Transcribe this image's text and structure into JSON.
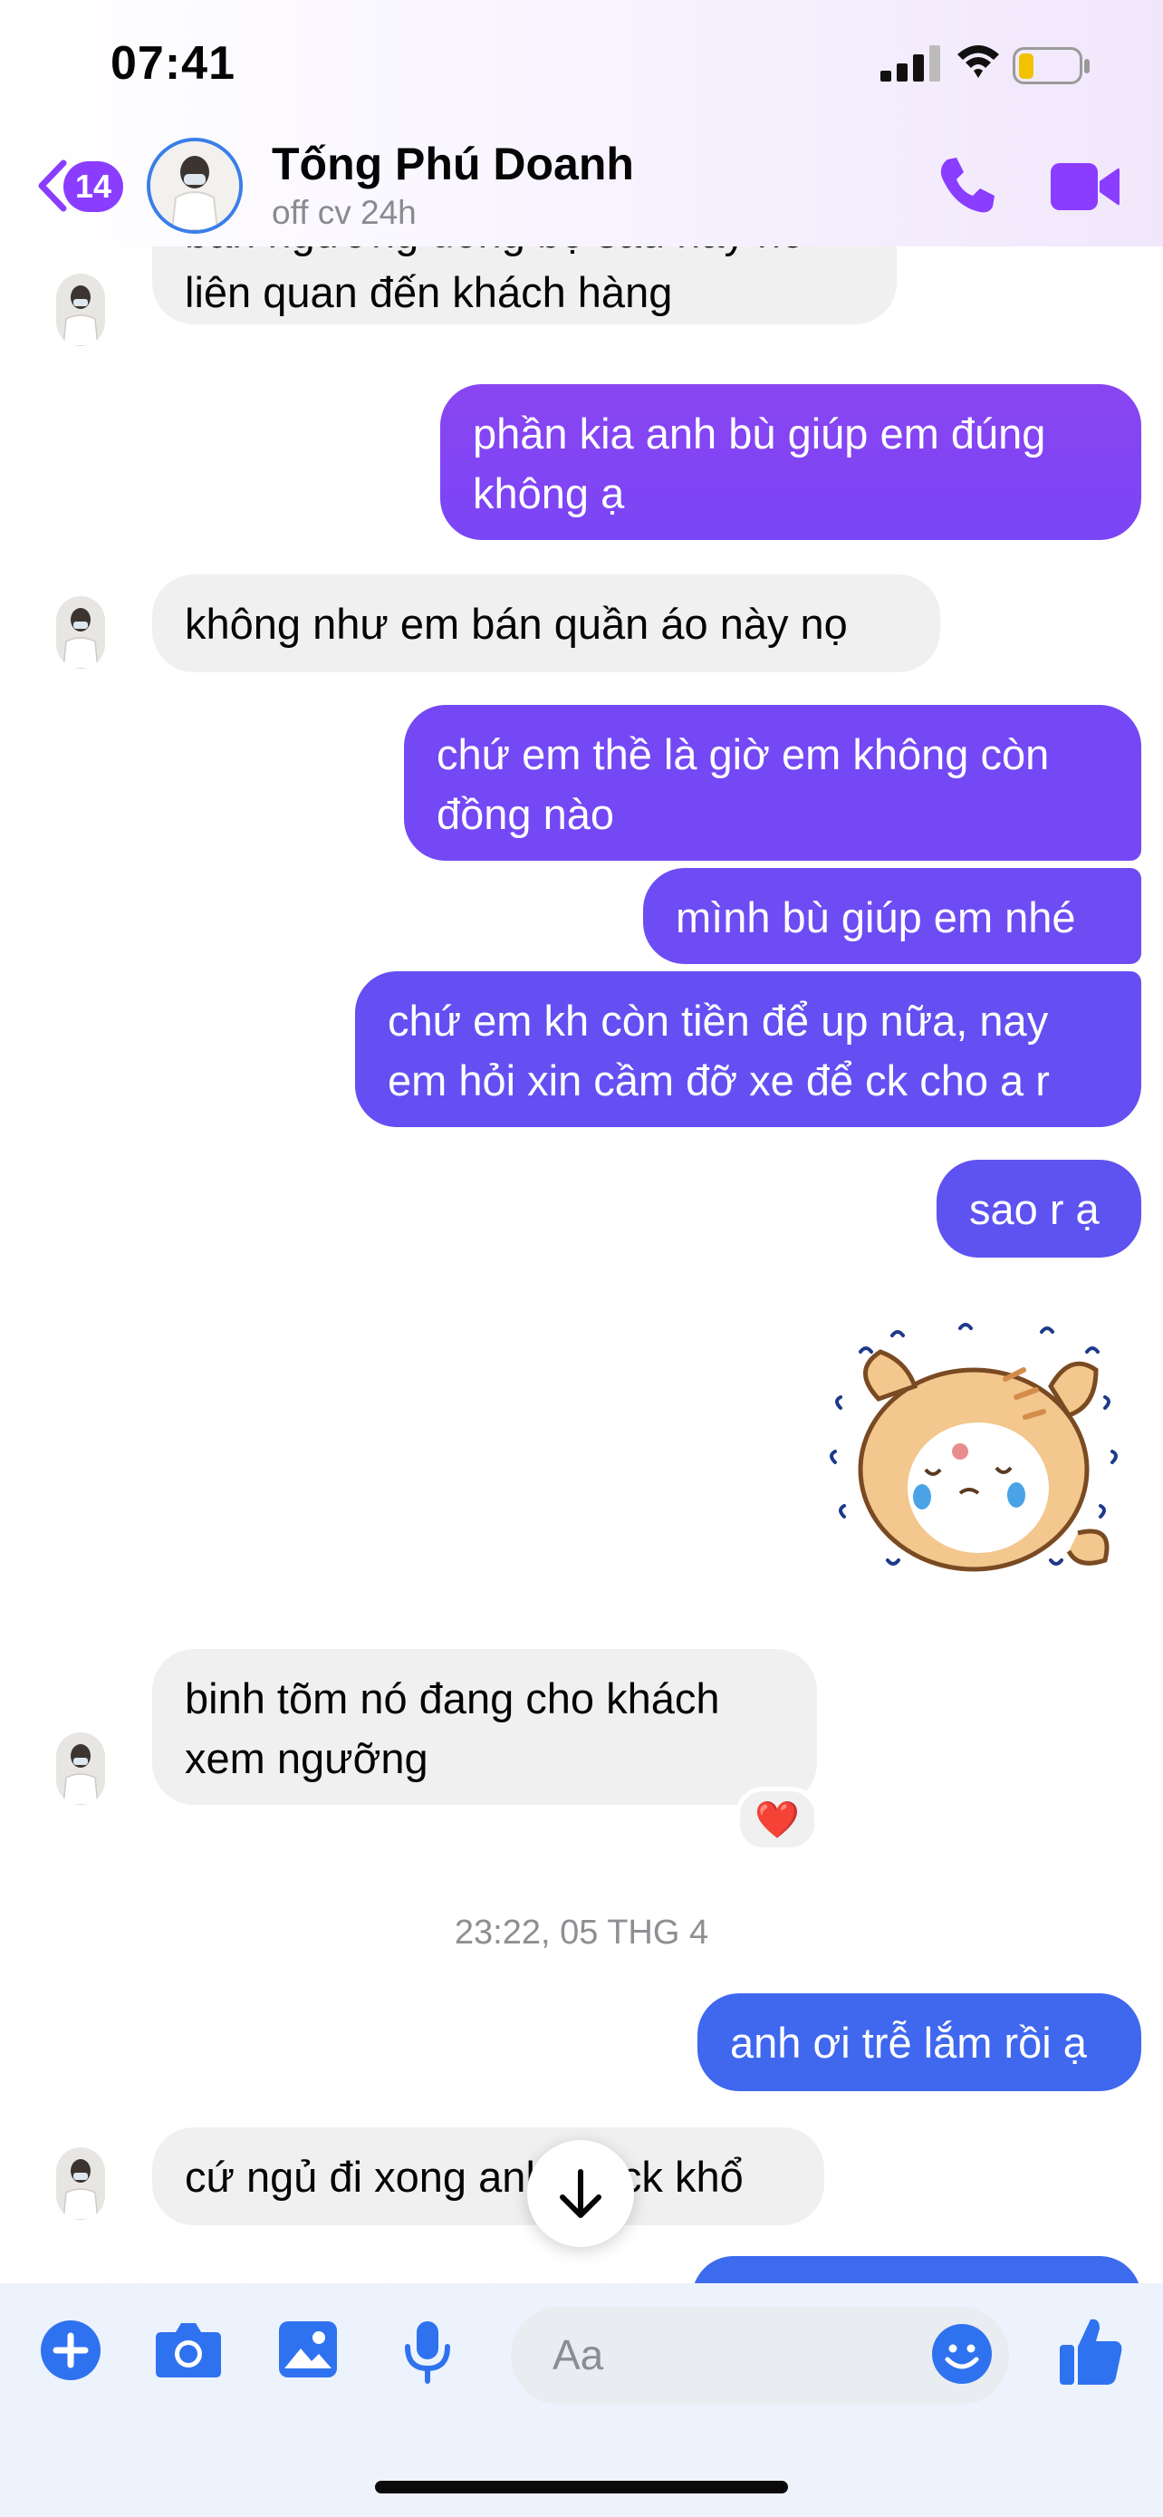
{
  "status_bar": {
    "time": "07:41"
  },
  "header": {
    "back_badge": "14",
    "contact_name": "Tống Phú Doanh",
    "contact_status": "off cv 24h"
  },
  "messages": [
    {
      "from": "them",
      "text_line1": "bán ngưỡng đồng bộ sau này nó",
      "text_line2": "liên quan đến khách hàng"
    },
    {
      "from": "me",
      "text_line1": "phần kia anh bù giúp em đúng",
      "text_line2": "không ạ"
    },
    {
      "from": "them",
      "text": "không như em bán quần áo này nọ"
    },
    {
      "from": "me",
      "text_line1": "chứ em thề là giờ em không còn",
      "text_line2": "đồng nào"
    },
    {
      "from": "me",
      "text": "mình bù giúp em nhé"
    },
    {
      "from": "me",
      "text_line1": "chứ em kh còn tiền để up nữa, nay",
      "text_line2": "em hỏi xin cầm đỡ xe để ck cho a r"
    },
    {
      "from": "me",
      "text": "sao r ạ"
    },
    {
      "from": "me",
      "type": "sticker",
      "sticker": "crying-cat-sticker"
    },
    {
      "from": "them",
      "text_line1": "binh tõm nó đang cho khách",
      "text_line2": "xem ngưỡng",
      "reaction": "❤️"
    },
    {
      "from": "me",
      "text": "anh ơi trễ lắm rồi ạ"
    },
    {
      "from": "them",
      "text": "cứ ngủ đi xong anh bù ck khổ"
    }
  ],
  "timestamp": "23:22, 05 THG 4",
  "composer": {
    "placeholder": "Aa",
    "icons": [
      "plus-icon",
      "camera-icon",
      "image-icon",
      "microphone-icon",
      "emoji-icon",
      "thumbs-up-icon"
    ]
  },
  "colors": {
    "accent": "#8a3dff",
    "bubble_purple": "#7b48f5",
    "bubble_violet": "#6c4ff2",
    "bubble_blue": "#3f68ef",
    "incoming": "#f0f0f0",
    "composer_icon": "#2f72f0"
  }
}
